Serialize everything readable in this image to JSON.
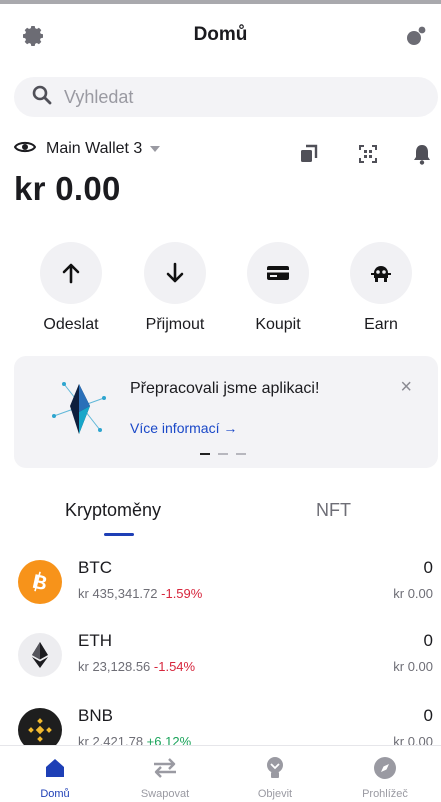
{
  "header": {
    "title": "Domů",
    "left_icon": "gear-icon",
    "right_icon": "wallet-connect-icon"
  },
  "search": {
    "placeholder": "Vyhledat",
    "value": ""
  },
  "wallet": {
    "name": "Main Wallet 3",
    "balance": "kr 0.00",
    "quick_icons": [
      "copy-icon",
      "scan-icon",
      "bell-icon"
    ]
  },
  "actions": [
    {
      "label": "Odeslat",
      "icon": "arrow-up-icon"
    },
    {
      "label": "Přijmout",
      "icon": "arrow-down-icon"
    },
    {
      "label": "Koupit",
      "icon": "card-icon"
    },
    {
      "label": "Earn",
      "icon": "earn-icon"
    }
  ],
  "banner": {
    "title": "Přepracovali jsme aplikaci!",
    "link": "Více informací →",
    "close": "×",
    "page_index": 1,
    "page_count": 3
  },
  "tabs": [
    {
      "label": "Kryptoměny",
      "active": true
    },
    {
      "label": "NFT",
      "active": false
    }
  ],
  "assets": [
    {
      "symbol": "BTC",
      "price": "kr 435,341.72",
      "change": "-1.59%",
      "direction": "down",
      "amount": "0",
      "fiat": "kr 0.00",
      "color": "#f7931a"
    },
    {
      "symbol": "ETH",
      "price": "kr 23,128.56",
      "change": "-1.54%",
      "direction": "down",
      "amount": "0",
      "fiat": "kr 0.00",
      "color": "#ededf0"
    },
    {
      "symbol": "BNB",
      "price": "kr 2,421.78",
      "change": "+6.12%",
      "direction": "up",
      "amount": "0",
      "fiat": "kr 0.00",
      "color": "#1e1e1e"
    }
  ],
  "bottom_nav": [
    {
      "label": "Domů",
      "icon": "home-icon",
      "active": true
    },
    {
      "label": "Swapovat",
      "icon": "swap-icon",
      "active": false
    },
    {
      "label": "Objevit",
      "icon": "discover-icon",
      "active": false
    },
    {
      "label": "Prohlížeč",
      "icon": "compass-icon",
      "active": false
    }
  ],
  "colors": {
    "accent": "#1e3fb6",
    "negative": "#d7263d",
    "positive": "#1aa35a"
  }
}
